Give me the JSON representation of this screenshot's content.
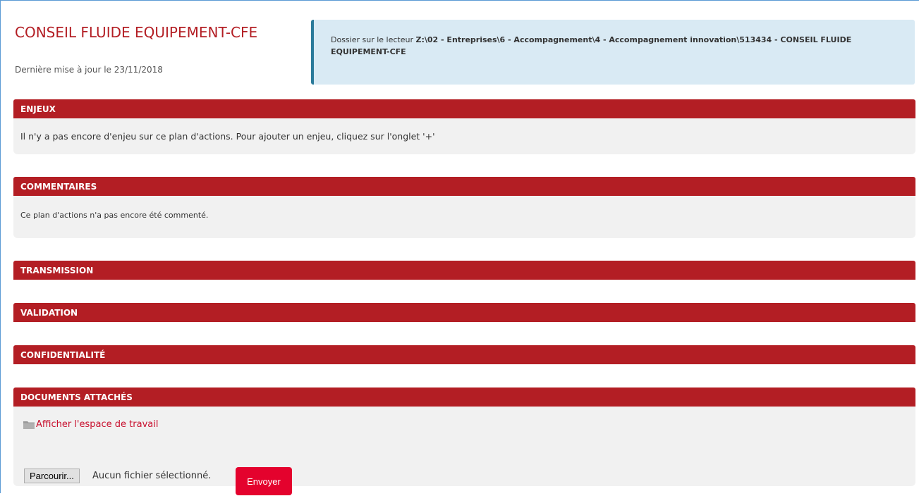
{
  "header": {
    "title": "CONSEIL FLUIDE EQUIPEMENT-CFE",
    "updated": "Dernière mise à jour le 23/11/2018"
  },
  "info": {
    "prefix": "Dossier sur le lecteur ",
    "path": "Z:\\02 - Entreprises\\6 - Accompagnement\\4 - Accompagnement innovation\\513434 - CONSEIL FLUIDE EQUIPEMENT-CFE"
  },
  "sections": {
    "enjeux": {
      "title": "ENJEUX",
      "text": "Il n'y a pas encore d'enjeu sur ce plan d'actions. Pour ajouter un enjeu, cliquez sur l'onglet '+'"
    },
    "commentaires": {
      "title": "COMMENTAIRES",
      "text": "Ce plan d'actions n'a pas encore été commenté."
    },
    "transmission": {
      "title": "TRANSMISSION"
    },
    "validation": {
      "title": "VALIDATION"
    },
    "confidentialite": {
      "title": "CONFIDENTIALITÉ"
    },
    "documents": {
      "title": "DOCUMENTS ATTACHÉS",
      "workspace_link": "Afficher l'espace de travail",
      "browse_label": "Parcourir...",
      "file_status": "Aucun fichier sélectionné.",
      "send_label": "Envoyer"
    }
  },
  "icons": {
    "workspace": "folder-icon"
  },
  "colors": {
    "primary_red": "#b31e24",
    "button_red": "#e4022d",
    "info_bg": "#d9eaf4",
    "info_border": "#2a7a9a",
    "section_bg": "#f1f1f1"
  }
}
